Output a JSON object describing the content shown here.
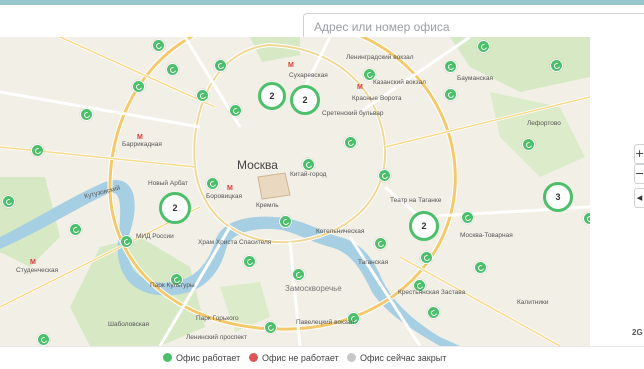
{
  "search": {
    "placeholder": "Адрес или номер офиса"
  },
  "map": {
    "city_label": "Москва",
    "clusters": [
      "2",
      "2",
      "2",
      "2",
      "3"
    ],
    "labels": [
      "Сухаревская",
      "Ленинградский вокзал",
      "Казанский вокзал",
      "Бауманская",
      "Красные Ворота",
      "Сретенский бульвар",
      "Лефортово",
      "Баррикадная",
      "Новый Арбат",
      "Боровицкая",
      "Кремль",
      "Китай-город",
      "Театр на Таганке",
      "Москва-Товарная",
      "Студенческая",
      "МИД России",
      "Храм Христа Спасителя",
      "Парк Культуры",
      "Замоскворечье",
      "Таганская",
      "Крестьянская Застава",
      "Павелецкий вокзал",
      "Калитники",
      "Парк Горького",
      "Ленинский проспект",
      "Шаболовская",
      "Котельническая",
      "Кутузовский"
    ]
  },
  "legend": {
    "working": "Офис работает",
    "not_working": "Офис не работает",
    "closed_now": "Офис сейчас закрыт"
  },
  "colors": {
    "working": "#4cbf6b",
    "not_working": "#e05454",
    "closed_now": "#c7c7c7"
  },
  "attribution": "2G",
  "controls": {
    "zoom_in": "+",
    "zoom_out": "−",
    "locate": "◂"
  }
}
